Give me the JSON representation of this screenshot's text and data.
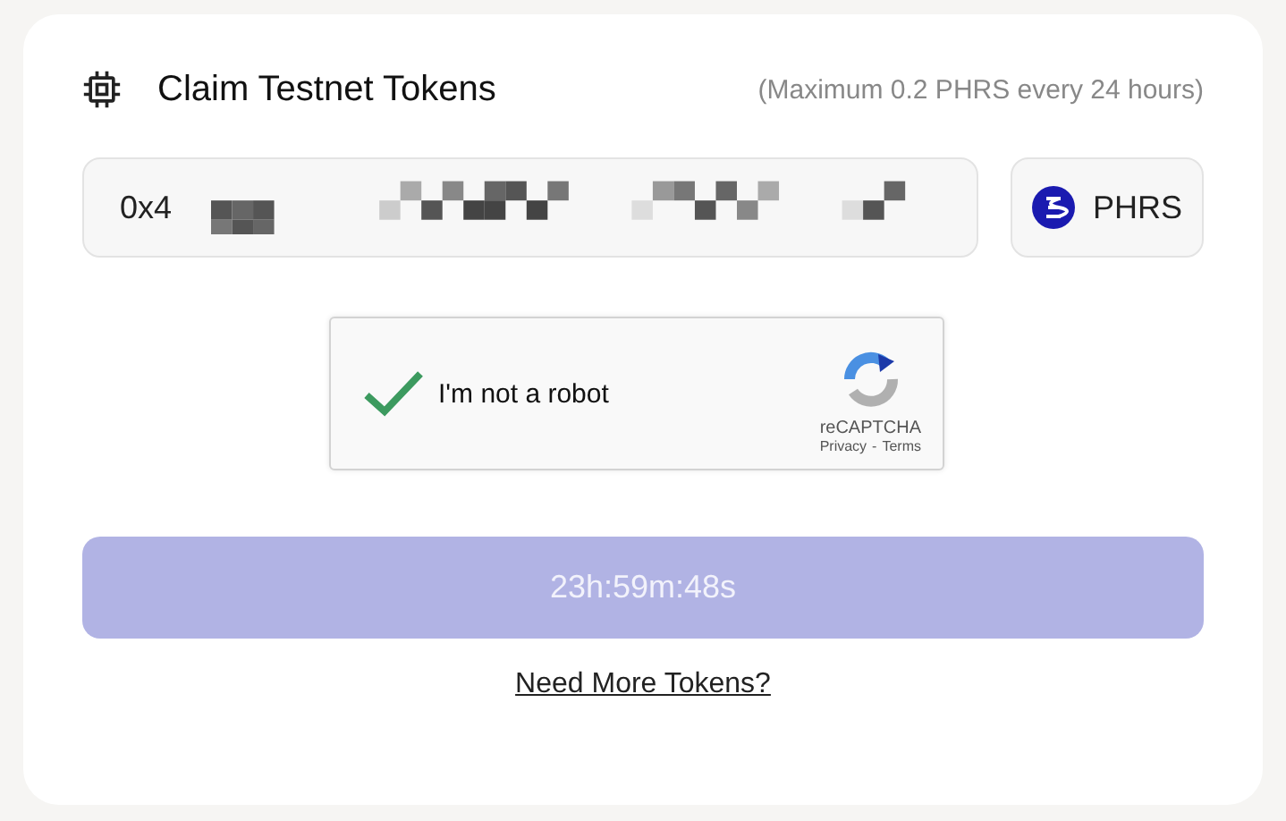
{
  "header": {
    "title": "Claim Testnet Tokens",
    "note": "(Maximum 0.2 PHRS every 24 hours)"
  },
  "address": {
    "value": "0x4",
    "redacted": true
  },
  "token": {
    "label": "PHRS"
  },
  "captcha": {
    "label": "I'm not a robot",
    "checked": true,
    "brand": "reCAPTCHA",
    "privacy": "Privacy",
    "separator": "-",
    "terms": "Terms"
  },
  "claim_button": {
    "label": "23h:59m:48s",
    "disabled": true
  },
  "link": {
    "label": "Need More Tokens?"
  }
}
